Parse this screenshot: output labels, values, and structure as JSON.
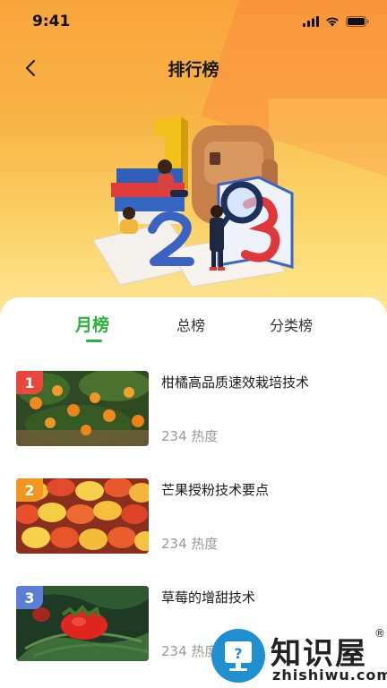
{
  "status_bar": {
    "time": "9:41"
  },
  "nav": {
    "title": "排行榜"
  },
  "tabs": [
    {
      "label": "月榜",
      "active": true
    },
    {
      "label": "总榜",
      "active": false
    },
    {
      "label": "分类榜",
      "active": false
    }
  ],
  "items": [
    {
      "rank": "1",
      "rank_color": "#e9473e",
      "title": "柑橘高品质速效栽培技术",
      "meta": "234 热度",
      "image": "orange-tree-photo"
    },
    {
      "rank": "2",
      "rank_color": "#f2961f",
      "title": "芒果授粉技术要点",
      "meta": "234 热度",
      "image": "mango-pile-photo"
    },
    {
      "rank": "3",
      "rank_color": "#5b7fd6",
      "title": "草莓的增甜技术",
      "meta": "234 热度",
      "image": "strawberry-photo"
    }
  ],
  "watermark": {
    "cn": "知识屋",
    "en": "zhishiwu.com",
    "mark": "®"
  },
  "colors": {
    "accent": "#27b43a",
    "hero_top": "#f7a53b",
    "hero_bottom": "#fde79a"
  }
}
